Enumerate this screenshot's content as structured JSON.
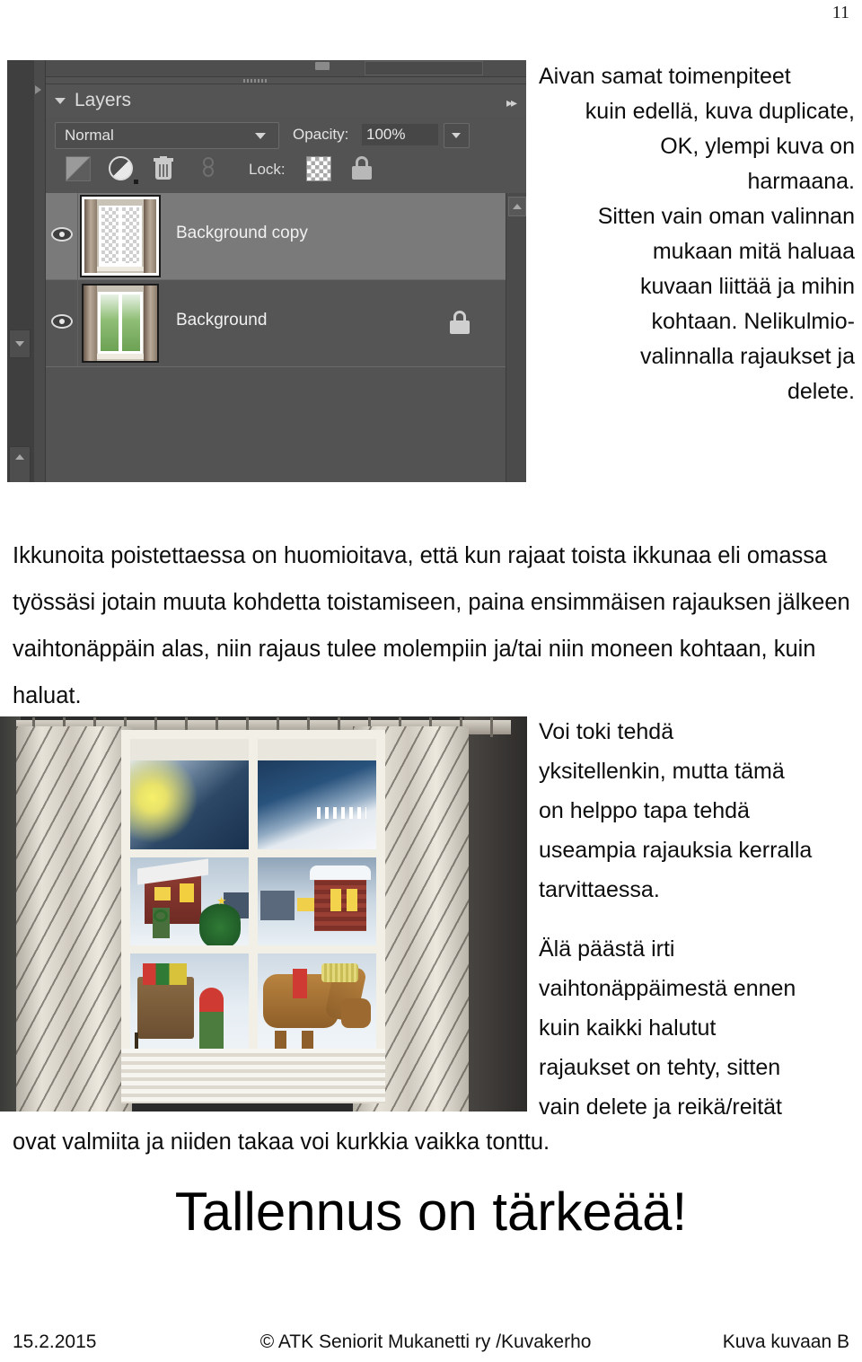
{
  "page": {
    "number": "11"
  },
  "photoshop": {
    "panel_title": "Layers",
    "blend_mode": "Normal",
    "opacity_label": "Opacity:",
    "opacity_value": "100%",
    "lock_label": "Lock:",
    "icons": {
      "collapse": "triangle-down-icon",
      "expand_chevrons": "▸▸",
      "gradient": "gradient-mask-icon",
      "adjustment": "adjustment-layer-icon",
      "trash": "trash-icon",
      "link": "link-layers-icon",
      "lock_transparent": "checkerboard-icon",
      "lock_all": "lock-icon"
    },
    "layers": [
      {
        "name": "Background copy",
        "selected": true,
        "visible": true,
        "locked": false
      },
      {
        "name": "Background",
        "selected": false,
        "visible": true,
        "locked": true
      }
    ]
  },
  "text": {
    "right_top": [
      "Aivan samat toimenpiteet",
      "kuin edellä, kuva duplicate,",
      "OK, ylempi kuva on",
      "harmaana.",
      "Sitten vain oman valinnan",
      "mukaan mitä haluaa",
      "kuvaan liittää ja mihin",
      "kohtaan. Nelikulmio-",
      "valinnalla rajaukset ja",
      "delete."
    ],
    "main_paragraph": "Ikkunoita poistettaessa on huomioitava, että kun rajaat toista ikkunaa eli omassa työssäsi jotain muuta kohdetta toistamiseen, paina ensimmäisen rajauksen jälkeen vaihtonäppäin alas, niin rajaus tulee molempiin ja/tai niin moneen kohtaan, kuin haluat.",
    "right_mid": [
      "Voi toki tehdä",
      "yksitellenkin, mutta tämä",
      "on helppo tapa tehdä",
      "useampia rajauksia kerralla",
      "tarvittaessa."
    ],
    "right_bottom": [
      "Älä päästä irti",
      "vaihtonäppäimestä ennen",
      "kuin kaikki halutut",
      "rajaukset on tehty, sitten",
      "vain delete ja reikä/reität"
    ],
    "caption_line": "ovat valmiita ja niiden takaa voi kurkkia vaikka tonttu.",
    "big_title": "Tallennus on tärkeää!"
  },
  "footer": {
    "date": "15.2.2015",
    "copyright": "© ATK Seniorit Mukanetti ry /Kuvakerho",
    "section": "Kuva kuvaan B"
  },
  "photo": {
    "alt": "winter-window-photo"
  }
}
